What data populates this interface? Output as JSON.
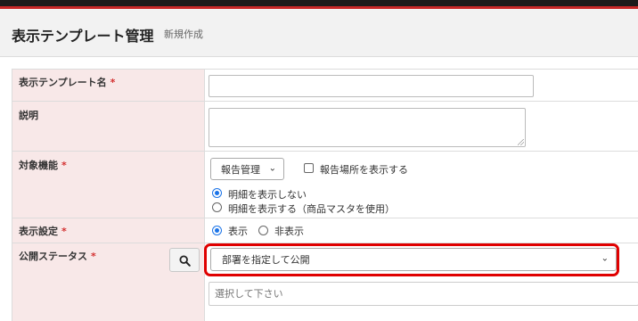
{
  "header": {
    "title": "表示テンプレート管理",
    "subtitle": "新規作成"
  },
  "form": {
    "template_name": {
      "label": "表示テンプレート名",
      "required_mark": "*",
      "value": ""
    },
    "description": {
      "label": "説明",
      "value": ""
    },
    "target_function": {
      "label": "対象機能",
      "required_mark": "*",
      "select_value": "報告管理",
      "show_location_checkbox_label": "報告場所を表示する",
      "show_location_checked": false,
      "radio_options": [
        {
          "label": "明細を表示しない",
          "checked": true
        },
        {
          "label": "明細を表示する（商品マスタを使用）",
          "checked": false
        }
      ]
    },
    "display_setting": {
      "label": "表示設定",
      "required_mark": "*",
      "radio_options": [
        {
          "label": "表示",
          "checked": true
        },
        {
          "label": "非表示",
          "checked": false
        }
      ]
    },
    "publish_status": {
      "label": "公開ステータス",
      "required_mark": "*",
      "select_value": "部署を指定して公開",
      "department_placeholder": "選択して下さい"
    }
  },
  "icons": {
    "search": "search-icon",
    "dropdown": "chevron-down-icon"
  },
  "colors": {
    "top_bar": "#1b1b1b",
    "accent_red": "#c62828",
    "label_background": "#f8e8e8",
    "highlight_border": "#e00000",
    "radio_selected": "#1a73e8"
  }
}
